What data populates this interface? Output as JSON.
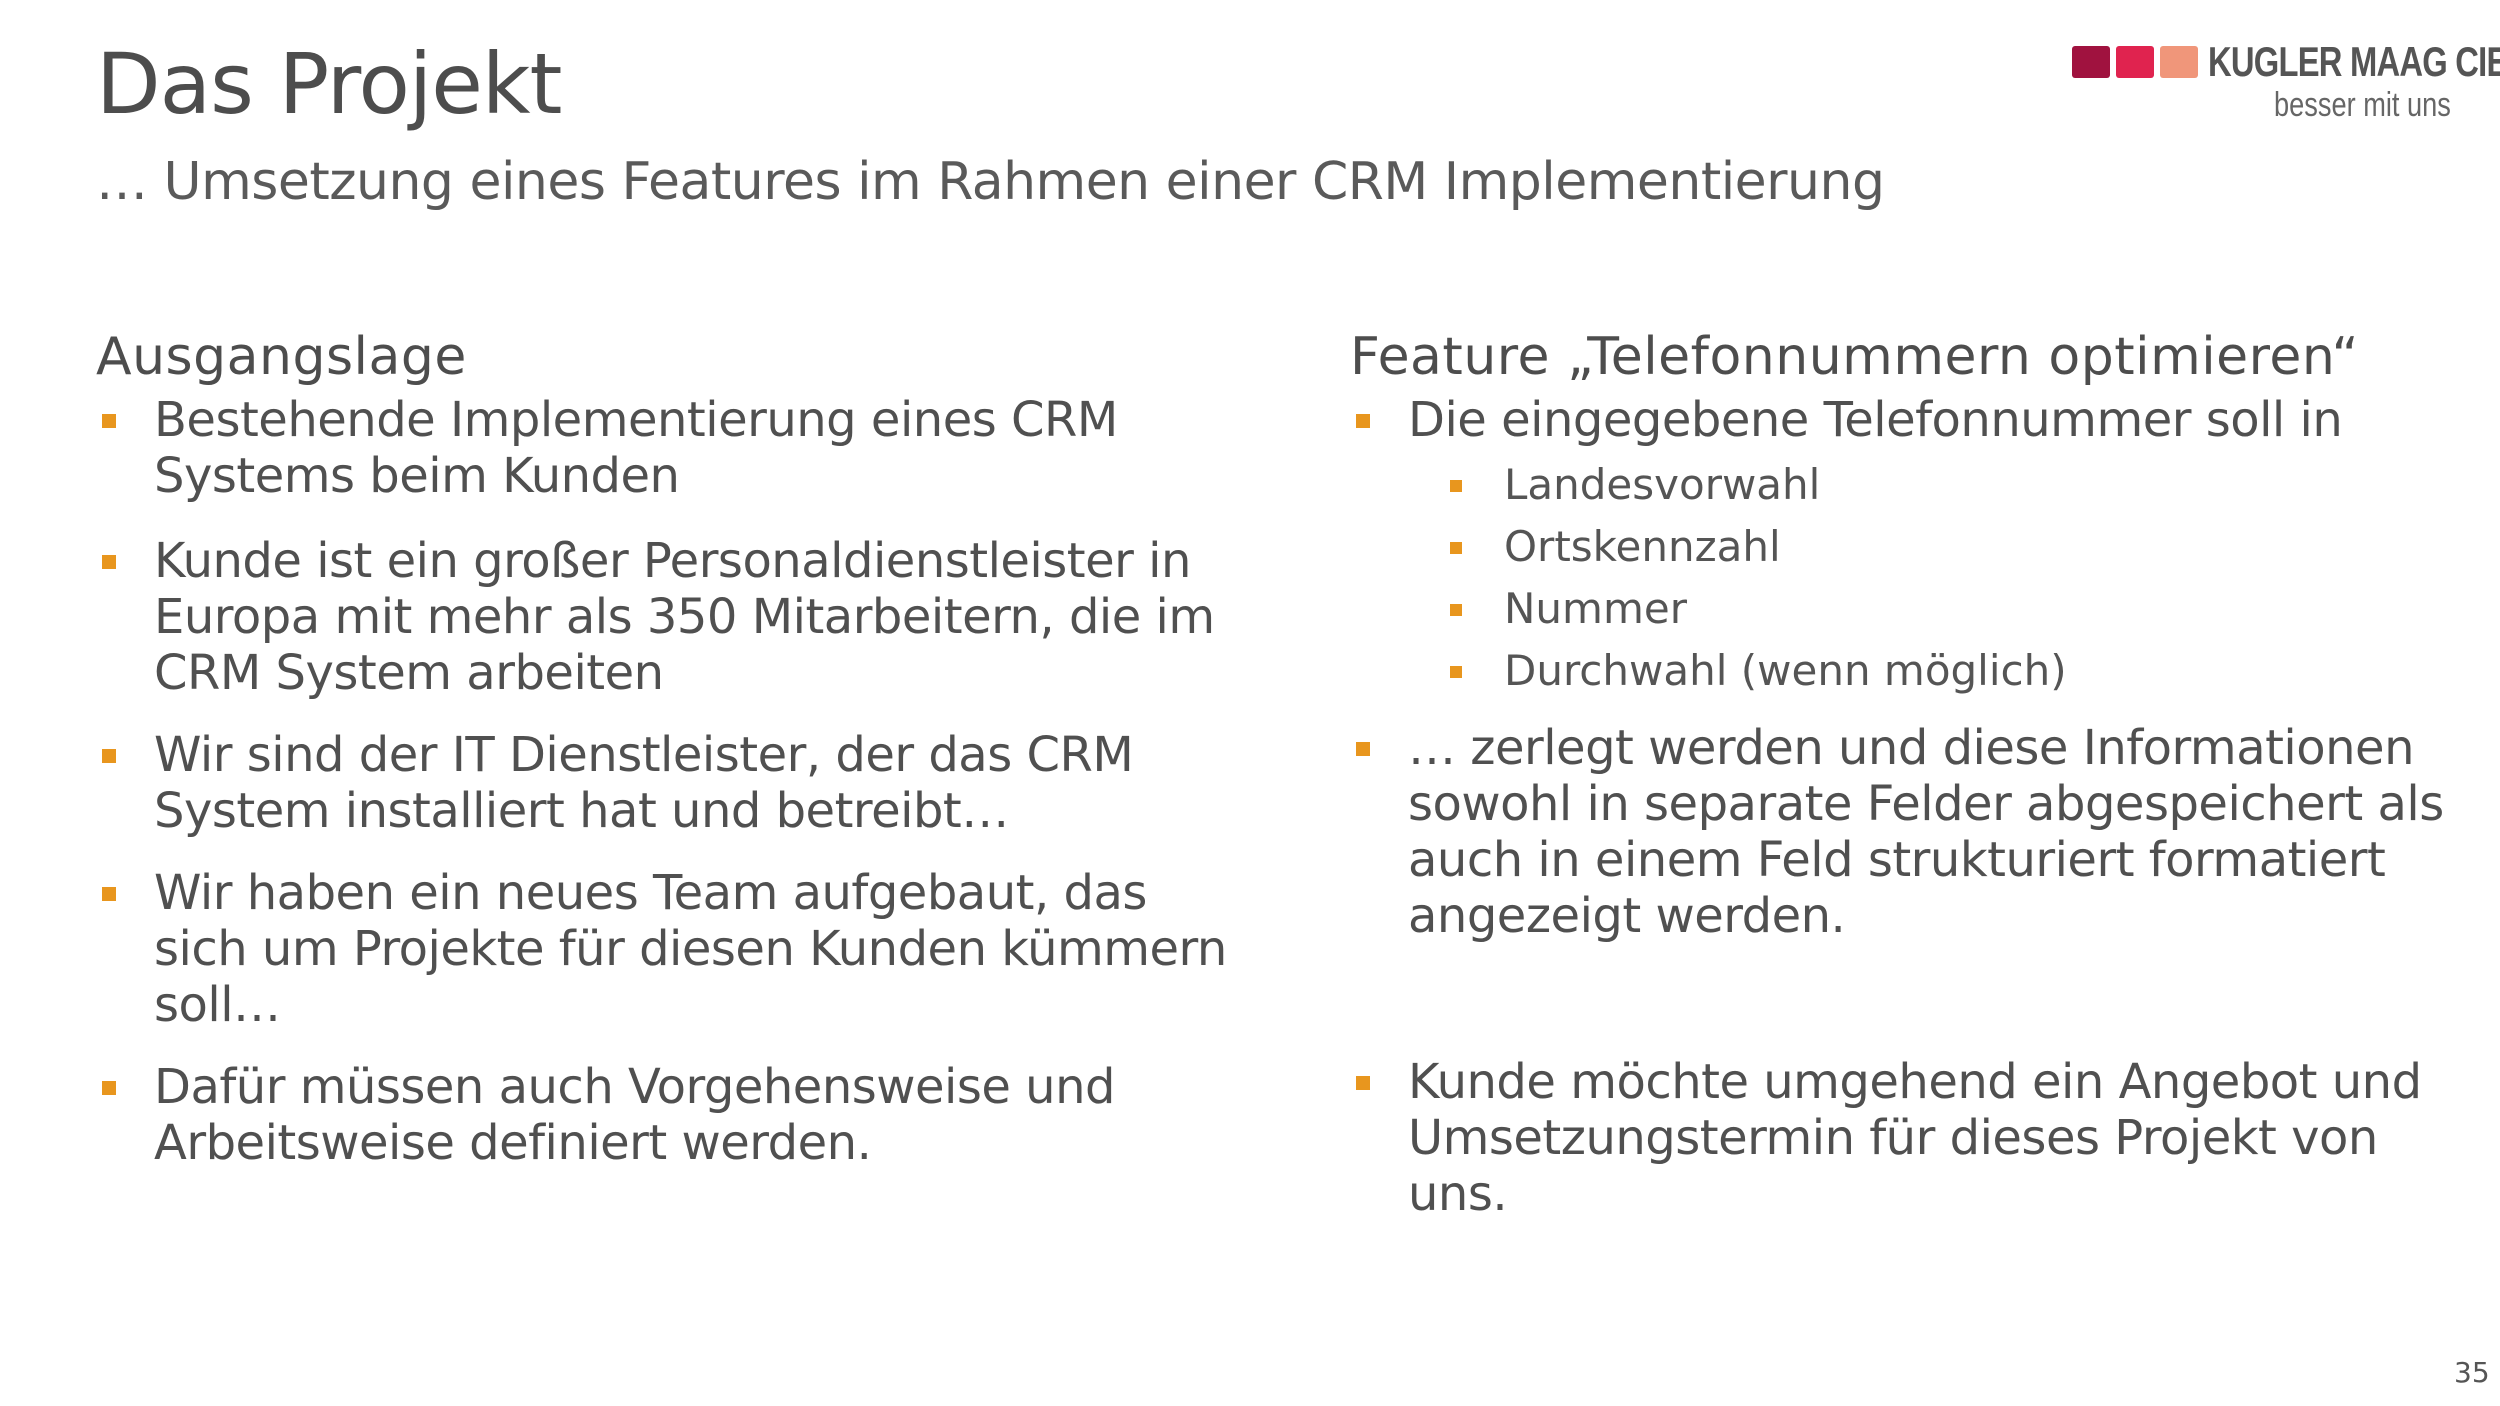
{
  "header": {
    "title": "Das Projekt",
    "subtitle": "… Umsetzung eines Features im Rahmen einer CRM Implementierung"
  },
  "logo": {
    "brand": "KUGLER MAAG CIE",
    "tagline": "besser mit uns",
    "colors": [
      "#a0123f",
      "#e0234f",
      "#f0967a"
    ]
  },
  "left": {
    "heading": "Ausgangslage",
    "items": [
      "Bestehende Implementierung eines CRM Systems beim Kunden",
      "Kunde ist ein großer Personaldienstleister in Europa mit mehr als 350 Mitarbeitern, die im CRM System arbeiten",
      "Wir sind der IT Dienstleister, der das CRM System installiert hat und betreibt…",
      "Wir haben ein neues Team aufgebaut, das sich um Projekte für diesen Kunden kümmern soll…",
      "Dafür müssen auch Vorgehensweise und Arbeitsweise definiert werden."
    ]
  },
  "right": {
    "heading": "Feature „Telefonnummern optimieren“",
    "items": [
      "Die eingegebene Telefonnummer soll in",
      "… zerlegt werden und diese Informationen sowohl in separate Felder abgespeichert als auch in einem Feld strukturiert formatiert angezeigt werden.",
      "Kunde möchte umgehend ein Angebot und Umsetzungstermin für dieses Projekt von uns."
    ],
    "subitems": [
      "Landesvorwahl",
      "Ortskennzahl",
      "Nummer",
      "Durchwahl (wenn möglich)"
    ]
  },
  "footer": {
    "page_number": "35"
  },
  "colors": {
    "bullet": "#e8961e",
    "text": "#505050"
  }
}
